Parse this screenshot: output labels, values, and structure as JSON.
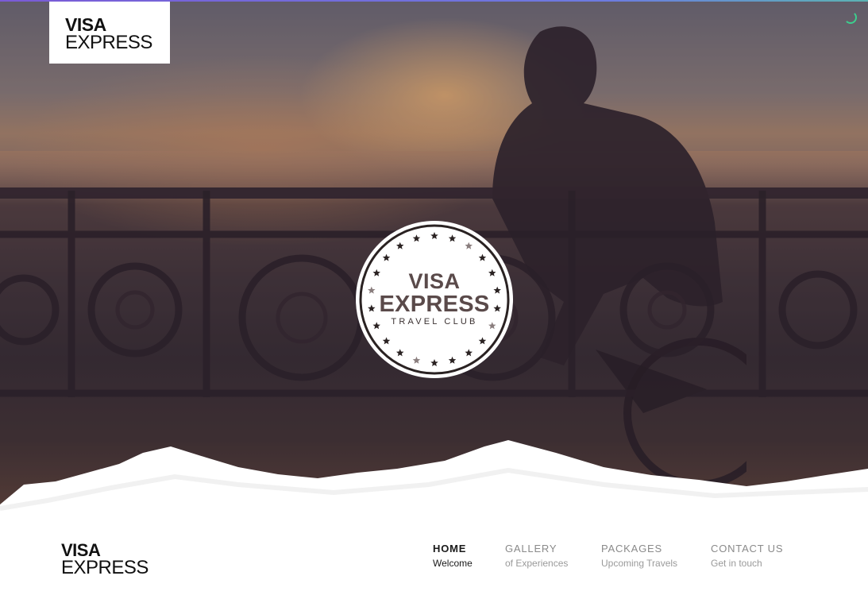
{
  "brand": {
    "logo_line1": "VISA",
    "logo_line2": "EXPRESS"
  },
  "badge": {
    "line1": "VISA",
    "line2": "EXPRESS",
    "line3": "TRAVEL CLUB"
  },
  "nav": {
    "items": [
      {
        "title": "HOME",
        "subtitle": "Welcome",
        "active": true
      },
      {
        "title": "GALLERY",
        "subtitle": "of Experiences",
        "active": false
      },
      {
        "title": "PACKAGES",
        "subtitle": "Upcoming Travels",
        "active": false
      },
      {
        "title": "CONTACT US",
        "subtitle": "Get in touch",
        "active": false
      }
    ]
  },
  "colors": {
    "accent_top_line": "#7a5bd6",
    "loader": "#3ccf8e",
    "active_nav": "#1a1a1a",
    "inactive_nav": "#8a8a8a"
  },
  "icons": {
    "loader": "loading-spinner-icon",
    "badge_stars": "star-icon"
  }
}
